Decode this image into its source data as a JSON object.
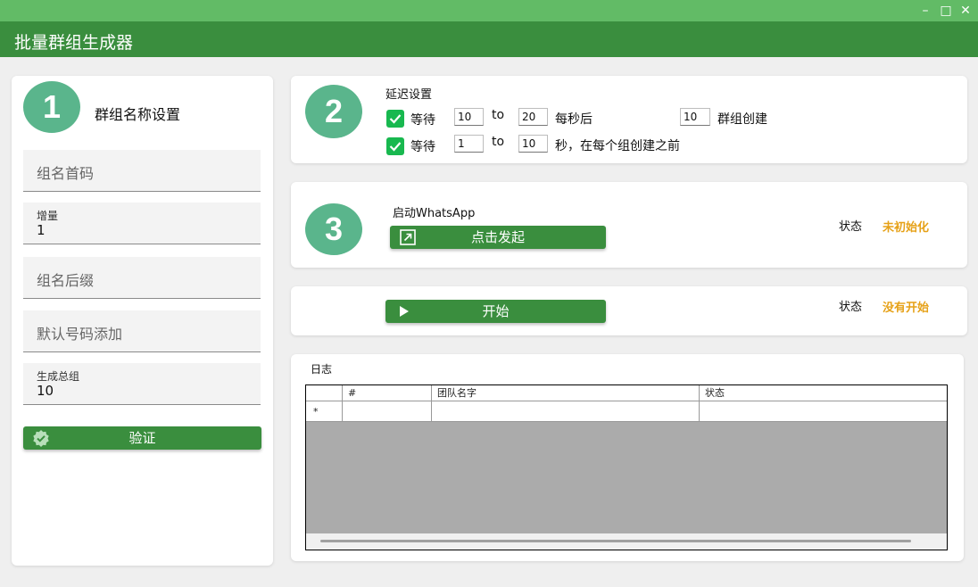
{
  "app": {
    "title": "批量群组生成器"
  },
  "window_controls": {
    "minimize": "–",
    "maximize": "□",
    "close": "✕"
  },
  "step1": {
    "number": "1",
    "title": "群组名称设置",
    "fields": {
      "prefix": {
        "placeholder": "组名首码"
      },
      "increment": {
        "label": "增量",
        "value": "1"
      },
      "suffix": {
        "placeholder": "组名后缀"
      },
      "default_number": {
        "placeholder": "默认号码添加"
      },
      "total": {
        "label": "生成总组",
        "value": "10"
      }
    },
    "verify_button": "验证"
  },
  "step2": {
    "number": "2",
    "title": "延迟设置",
    "row1": {
      "wait_label": "等待",
      "from": "10",
      "to_label": "to",
      "to": "20",
      "after_label": "每秒后",
      "group_count": "10",
      "group_label": "群组创建"
    },
    "row2": {
      "wait_label": "等待",
      "from": "1",
      "to_label": "to",
      "to": "10",
      "after_label": "秒，在每个组创建之前"
    }
  },
  "step3": {
    "number": "3",
    "title": "启动WhatsApp",
    "launch_button": "点击发起",
    "status_label": "状态",
    "status_value": "未初始化"
  },
  "start": {
    "button": "开始",
    "status_label": "状态",
    "status_value": "没有开始"
  },
  "log": {
    "title": "日志",
    "columns": [
      "#",
      "团队名字",
      "状态"
    ],
    "new_row_marker": "*"
  },
  "colors": {
    "accent": "#3a8e3e",
    "topstrip": "#62bb66",
    "step_circle": "#5ab58c",
    "checkbox": "#18b84f",
    "status": "#e6a117"
  }
}
